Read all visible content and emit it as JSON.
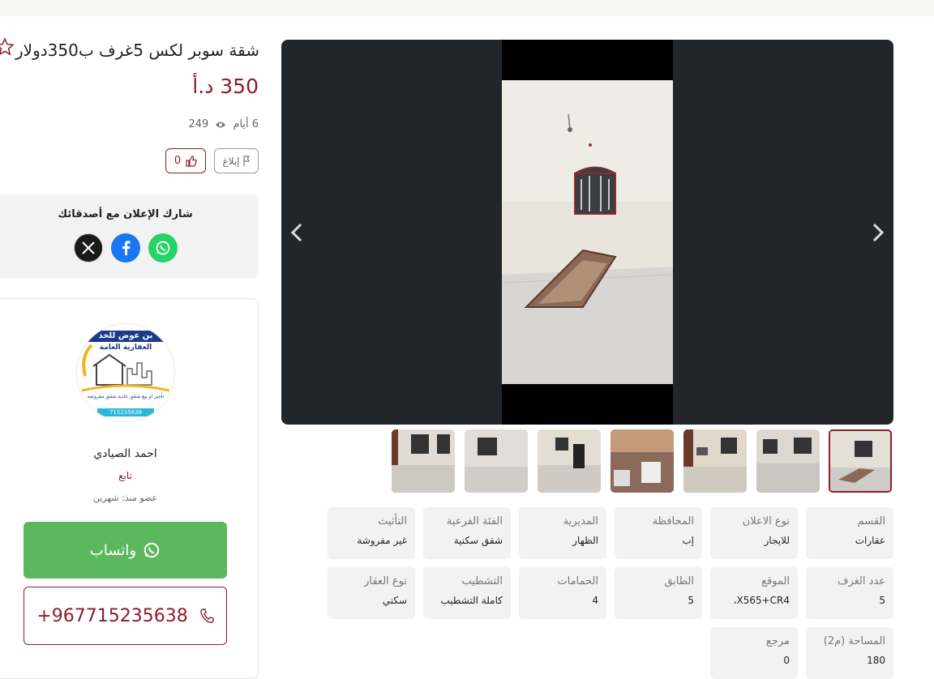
{
  "listing": {
    "title": "شقة سوبر لكس 5غرف ب350دولار",
    "price": "350 د.أ",
    "age": "6 أيام",
    "views": "249",
    "likes": "0",
    "report_label": "إبلاغ"
  },
  "share": {
    "title": "شارك الإعلان مع أصدقائك",
    "networks": [
      "x-icon",
      "facebook-icon",
      "whatsapp-icon"
    ]
  },
  "seller": {
    "name": "احمد الصيادي",
    "follow_label": "تابع",
    "member_since": "عضو منذ: شهرين",
    "whatsapp_label": "واتساب",
    "phone": "+967715235638",
    "logo_text": {
      "line1": "بن عوض للخد",
      "line2": "العقارية العامة",
      "line3": "تأجير او بيع شقق عادية شقق مفروشة",
      "phone": "715235638"
    }
  },
  "gallery": {
    "thumb_count": 7,
    "active_index": 0
  },
  "details": [
    {
      "label": "القسم",
      "value": "عقارات"
    },
    {
      "label": "نوع الاعلان",
      "value": "للايجار"
    },
    {
      "label": "المحافظة",
      "value": "إب"
    },
    {
      "label": "المديرية",
      "value": "الظهار"
    },
    {
      "label": "الفئة الفرعية",
      "value": "شقق سكنية"
    },
    {
      "label": "التأثيث",
      "value": "غير مفروشة"
    },
    {
      "label": "عدد الغرف",
      "value": "5"
    },
    {
      "label": "الموقع",
      "value": "X565+CR4،"
    },
    {
      "label": "الطابق",
      "value": "5"
    },
    {
      "label": "الحمامات",
      "value": "4"
    },
    {
      "label": "التشطيب",
      "value": "كاملة التشطيب"
    },
    {
      "label": "نوع العقار",
      "value": "سكني"
    },
    {
      "label": "المساحة (م2)",
      "value": "180"
    },
    {
      "label": "مرجع",
      "value": "0"
    }
  ],
  "colors": {
    "brand": "#8b1d2c",
    "whatsapp": "#5cb85c"
  }
}
